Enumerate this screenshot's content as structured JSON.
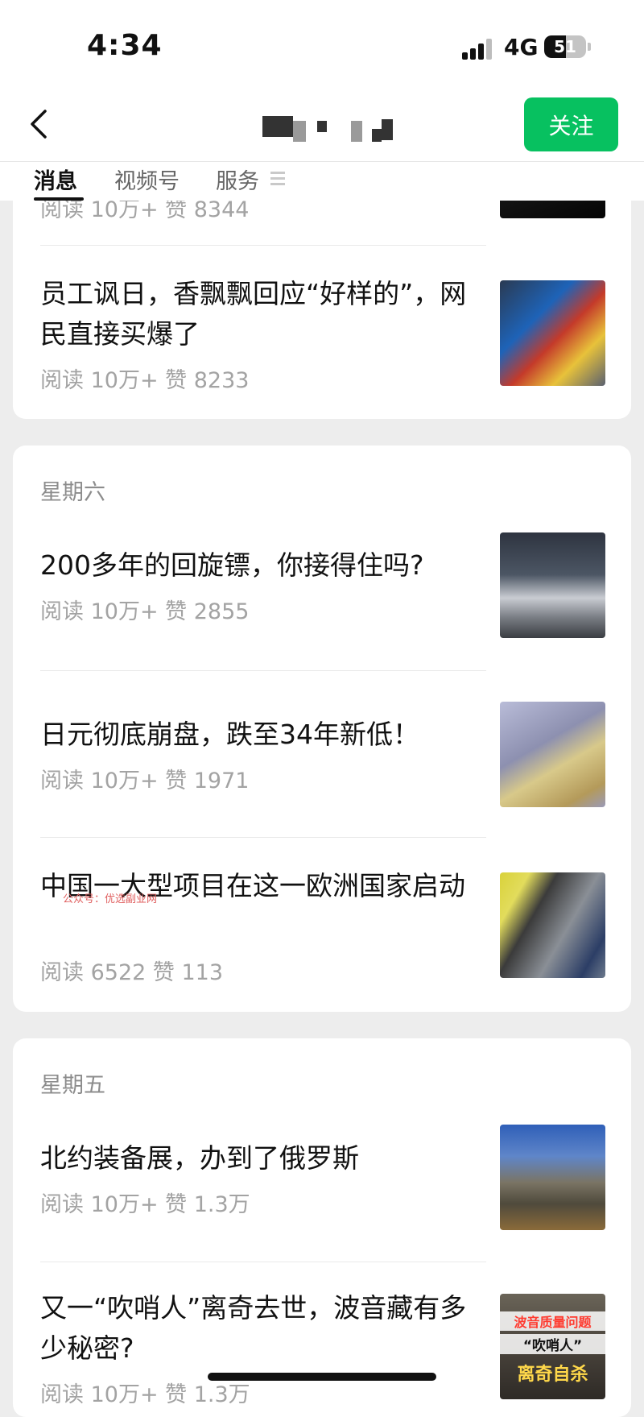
{
  "status_bar": {
    "time": "4:34",
    "network": "4G",
    "battery": "51"
  },
  "header": {
    "follow_label": "关注"
  },
  "tabs": [
    {
      "label": "消息"
    },
    {
      "label": "视频号"
    },
    {
      "label": "服务"
    }
  ],
  "card1": {
    "partial_meta": "阅读 10万+  赞 8344",
    "article": {
      "title": "员工讽日，香飘飘回应“好样的”，网民直接买爆了",
      "meta": "阅读 10万+  赞 8233"
    }
  },
  "card2": {
    "day": "星期六",
    "articles": [
      {
        "title": "200多年的回旋镖，你接得住吗?",
        "meta": "阅读 10万+  赞 2855"
      },
      {
        "title": "日元彻底崩盘，跌至34年新低！",
        "meta": "阅读 10万+  赞 1971"
      },
      {
        "title": "中国一大型项目在这一欧洲国家启动",
        "meta": "阅读 6522  赞 113"
      }
    ]
  },
  "card3": {
    "day": "星期五",
    "articles": [
      {
        "title": "北约装备展，办到了俄罗斯",
        "meta": "阅读 10万+  赞 1.3万"
      },
      {
        "title": "又一“吹哨人”离奇去世，波音藏有多少秘密?",
        "meta": "阅读 10万+  赞 1.3万",
        "thumb_text": [
          "波音质量问题",
          "“吹哨人”",
          "离奇自杀"
        ]
      }
    ]
  },
  "watermark": "公众号：优选副业网",
  "colors": {
    "accent": "#07c160",
    "meta": "#a3a3a3",
    "background": "#ededed"
  },
  "icons": {
    "back": "chevron-left-icon",
    "menu": "menu-icon",
    "signal": "signal-icon",
    "battery": "battery-icon"
  }
}
